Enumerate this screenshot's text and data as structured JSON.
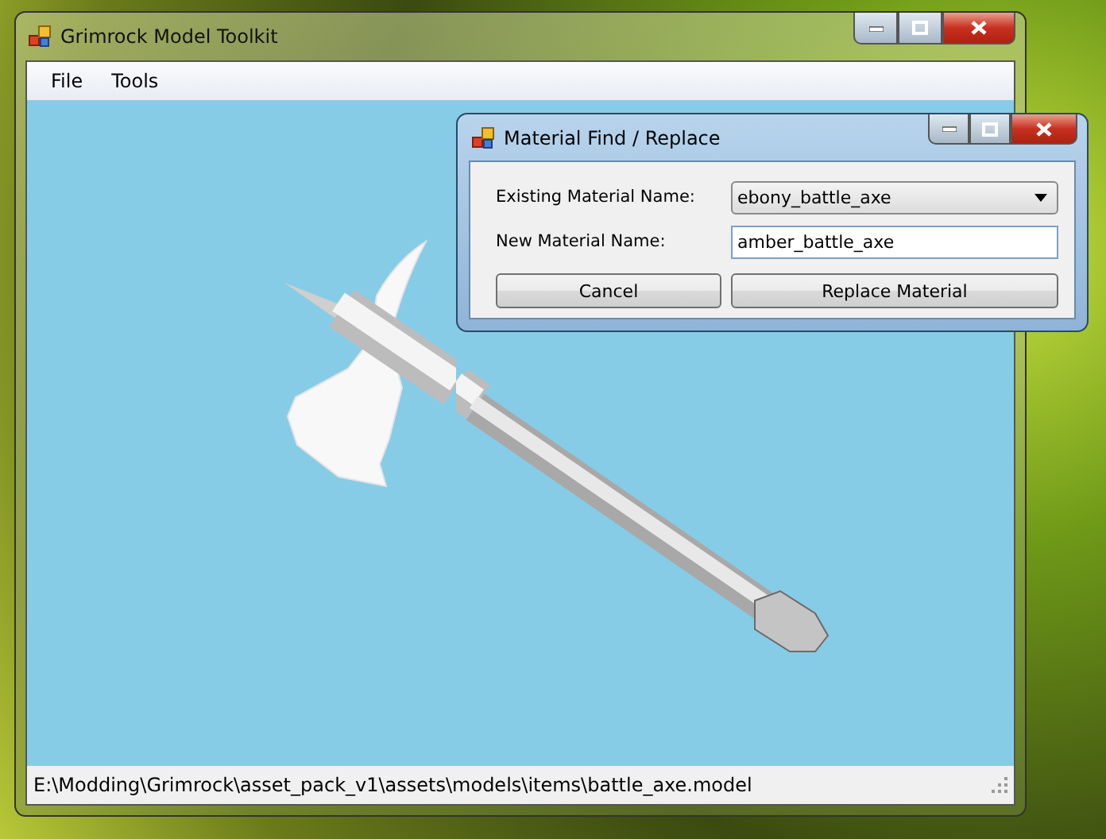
{
  "main_window": {
    "title": "Grimrock Model Toolkit",
    "menu": [
      "File",
      "Tools"
    ],
    "status_bar": "E:\\Modding\\Grimrock\\asset_pack_v1\\assets\\models\\items\\battle_axe.model"
  },
  "dialog": {
    "title": "Material Find / Replace",
    "fields": [
      {
        "kind": "dropdown",
        "label": "Existing Material Name:",
        "value": "ebony_battle_axe"
      },
      {
        "kind": "text",
        "label": "New Material Name:",
        "value": "amber_battle_axe"
      }
    ],
    "buttons": [
      "Cancel",
      "Replace Material"
    ]
  }
}
